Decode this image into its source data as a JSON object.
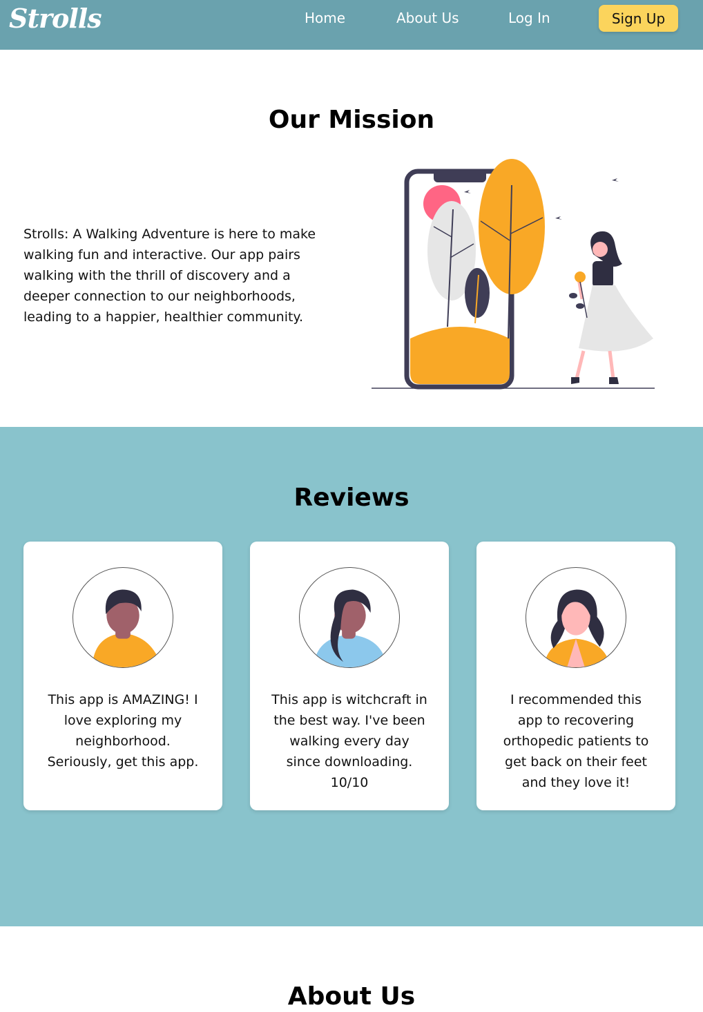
{
  "nav": {
    "logo": "Strolls",
    "links": [
      "Home",
      "About Us",
      "Log In"
    ],
    "signup": "Sign Up"
  },
  "mission": {
    "title": "Our Mission",
    "text": "Strolls: A Walking Adventure is here to make walking fun and interactive. Our app pairs walking with the thrill of discovery and a deeper connection to our neighborhoods, leading to a happier, healthier community."
  },
  "reviews": {
    "title": "Reviews",
    "items": [
      {
        "text": "This app is AMAZING! I love exploring my neighborhood. Seriously, get this app."
      },
      {
        "text": "This app is witchcraft in the best way. I've been walking every day since downloading. 10/10"
      },
      {
        "text": "I recommended this app to recovering orthopedic patients to get back on their feet and they love it!"
      }
    ]
  },
  "about": {
    "title": "About Us"
  },
  "colors": {
    "nav": "#6aa2ae",
    "reviews_bg": "#89c3cc",
    "accent_yellow": "#fbd45c",
    "illustration_orange": "#f9a826",
    "illustration_pink": "#ff6584",
    "illustration_dark": "#3f3d56"
  }
}
